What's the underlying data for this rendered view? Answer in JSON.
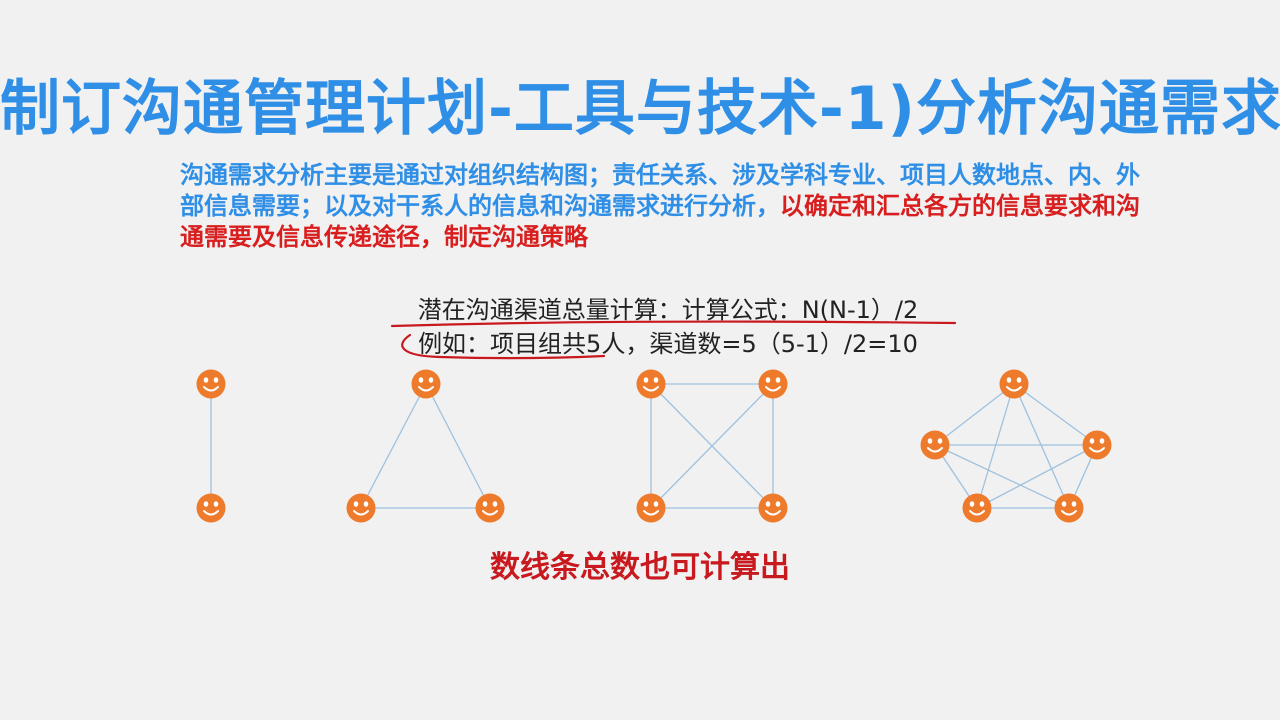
{
  "title": "制订沟通管理计划-工具与技术-1)分析沟通需求",
  "description": {
    "blue_part": "沟通需求分析主要是通过对组织结构图；责任关系、涉及学科专业、项目人数地点、内、外部信息需要；以及对干系人的信息和沟通需求进行分析，",
    "red_part": "以确定和汇总各方的信息要求和沟通需要及信息传递途径，制定沟通策略"
  },
  "formula": {
    "line1": "潜在沟通渠道总量计算：计算公式：N(N-1）/2",
    "line2": "例如：项目组共5人，渠道数=5（5-1）/2=10"
  },
  "caption": "数线条总数也可计算出",
  "colors": {
    "title": "#2f8fe6",
    "highlight_red": "#d81e1e",
    "node_orange": "#ee7a2c",
    "edge_blue": "#9fc1de",
    "underline_red": "#c8191f"
  },
  "graphs": [
    {
      "node_count": 2,
      "icon": "smiley-face-icon"
    },
    {
      "node_count": 3,
      "icon": "smiley-face-icon"
    },
    {
      "node_count": 4,
      "icon": "smiley-face-icon"
    },
    {
      "node_count": 5,
      "icon": "smiley-face-icon"
    }
  ]
}
